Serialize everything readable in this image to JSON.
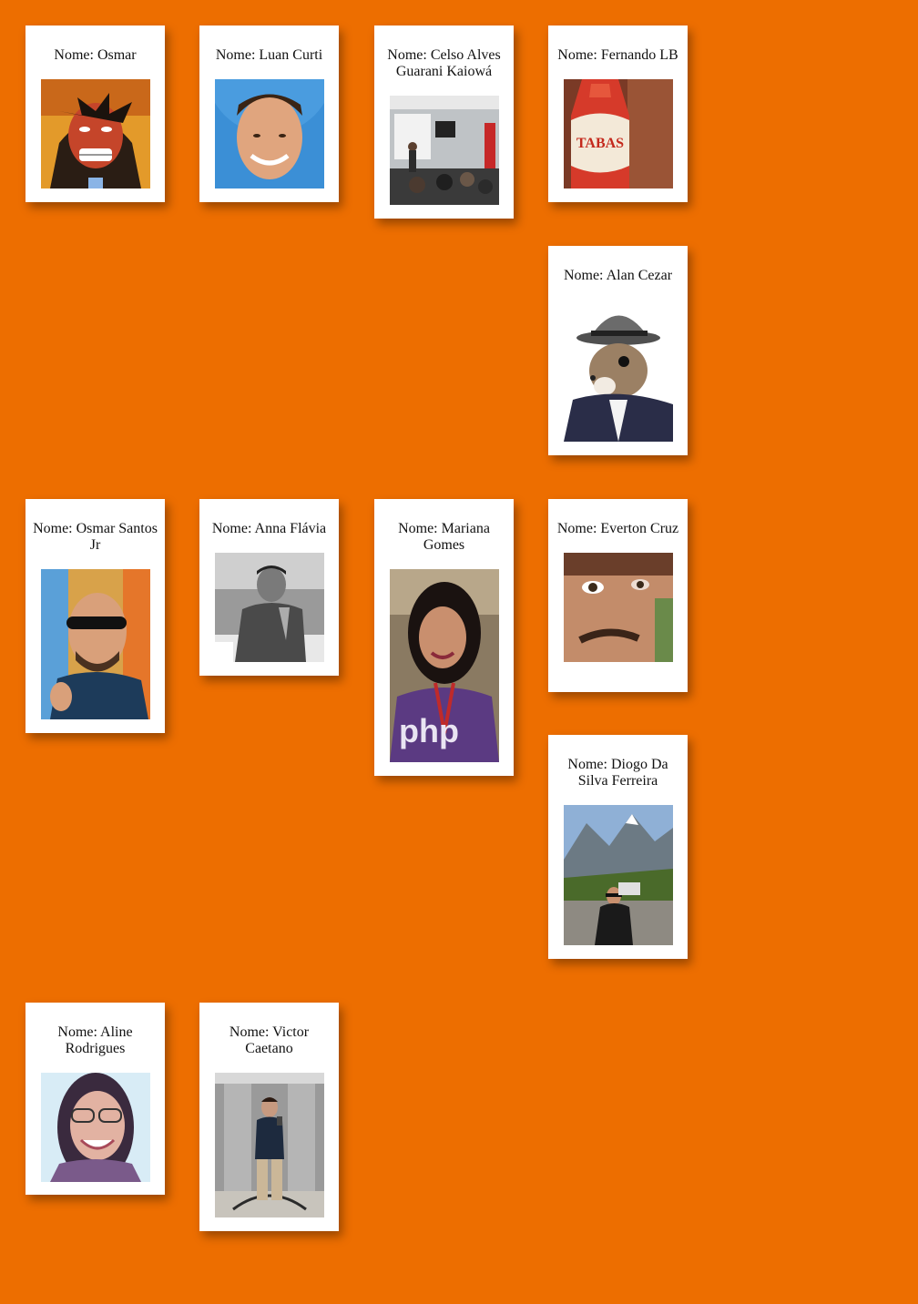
{
  "page": {
    "background": "#ED6E00"
  },
  "cards": [
    {
      "id": "osmar",
      "label": "Nome: Osmar",
      "photo": "comic-villain-avatar"
    },
    {
      "id": "luan-curti",
      "label": "Nome: Luan Curti",
      "photo": "smiling-man-blue-background"
    },
    {
      "id": "celso-alves",
      "label": "Nome: Celso Alves Guarani Kaiowá",
      "photo": "classroom-presentation"
    },
    {
      "id": "fernando-lb",
      "label": "Nome: Fernando LB",
      "photo": "hot-sauce-bottle"
    },
    {
      "id": "alan-cezar",
      "label": "Nome: Alan Cezar",
      "photo": "squirrel-in-hat"
    },
    {
      "id": "osmar-santos-jr",
      "label": "Nome: Osmar Santos Jr",
      "photo": "man-sunglasses-thumbs-up"
    },
    {
      "id": "anna-flavia",
      "label": "Nome: Anna Flávia",
      "photo": "man-at-table-grayscale"
    },
    {
      "id": "mariana-gomes",
      "label": "Nome: Mariana Gomes",
      "photo": "woman-php-shirt"
    },
    {
      "id": "everton-cruz",
      "label": "Nome: Everton Cruz",
      "photo": "man-closeup-face"
    },
    {
      "id": "diogo-ferreira",
      "label": "Nome: Diogo Da Silva Ferreira",
      "photo": "man-mountain-landscape"
    },
    {
      "id": "aline-rodrigues",
      "label": "Nome: Aline Rodrigues",
      "photo": "woman-glasses-selfie"
    },
    {
      "id": "victor-caetano",
      "label": "Nome: Victor Caetano",
      "photo": "man-elevator-mirror-selfie"
    }
  ]
}
